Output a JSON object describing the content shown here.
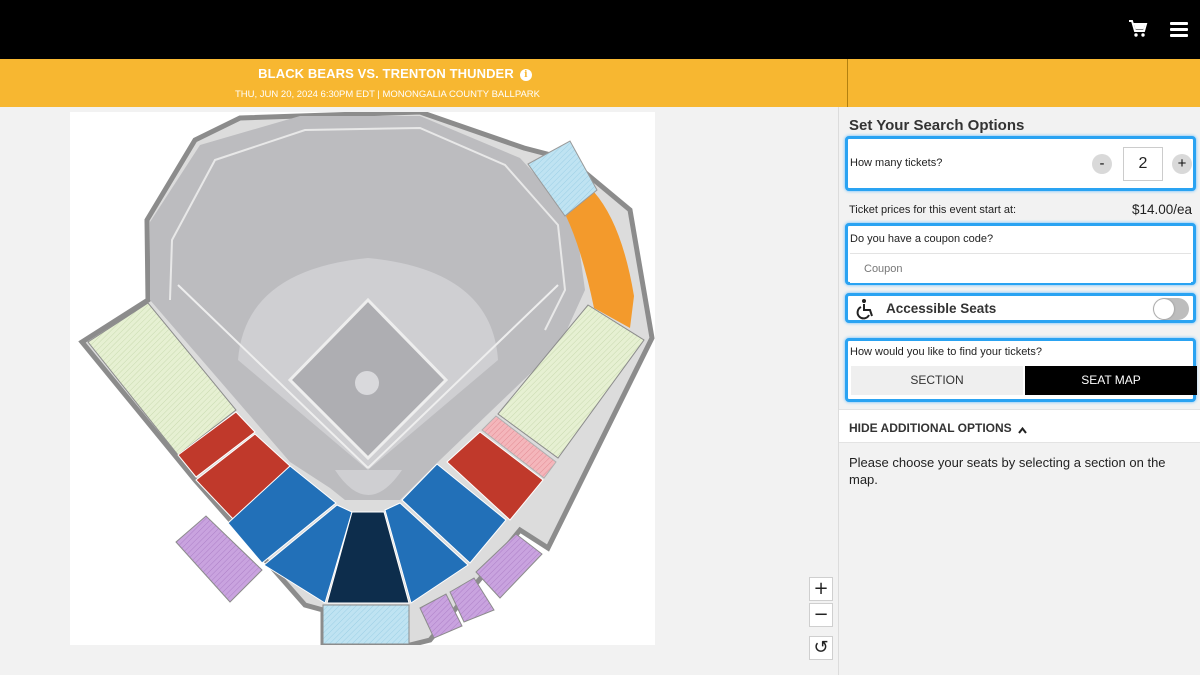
{
  "header": {
    "cart_icon": "cart-icon",
    "menu_icon": "hamburger-menu-icon"
  },
  "event": {
    "title": "BLACK BEARS VS. TRENTON THUNDER",
    "subtitle": "THU, JUN 20, 2024 6:30PM EDT | MONONGALIA COUNTY BALLPARK",
    "info_icon": "i"
  },
  "colors": {
    "event_bar": "#f7b731",
    "focus_outline": "#2aa3f2",
    "field_gray": "#bcbcbf",
    "section_lightgreen": "#e6f0d2",
    "section_red": "#c0392b",
    "section_pink": "#f4b6bb",
    "section_blue": "#2270b8",
    "section_navy": "#0d2d4c",
    "section_lightblue": "#bfe3f2",
    "section_purple": "#c9a3df",
    "section_orange": "#f39a2c"
  },
  "map": {
    "zoom_in": "+",
    "zoom_out": "−",
    "reset": "↺"
  },
  "search": {
    "title": "Set Your Search Options",
    "tickets_label": "How many tickets?",
    "minus": "-",
    "plus": "+",
    "quantity": "2",
    "price_label": "Ticket prices for this event start at:",
    "price_value": "$14.00/ea",
    "coupon_label": "Do you have a coupon code?",
    "coupon_placeholder": "Coupon",
    "accessible_label": "Accessible Seats",
    "accessible_on": false,
    "find_label": "How would you like to find your tickets?",
    "option_section": "SECTION",
    "option_map": "SEAT MAP",
    "selected_option": "SEAT MAP",
    "hide_options": "HIDE ADDITIONAL OPTIONS",
    "instructions": "Please choose your seats by selecting a section on the map."
  }
}
